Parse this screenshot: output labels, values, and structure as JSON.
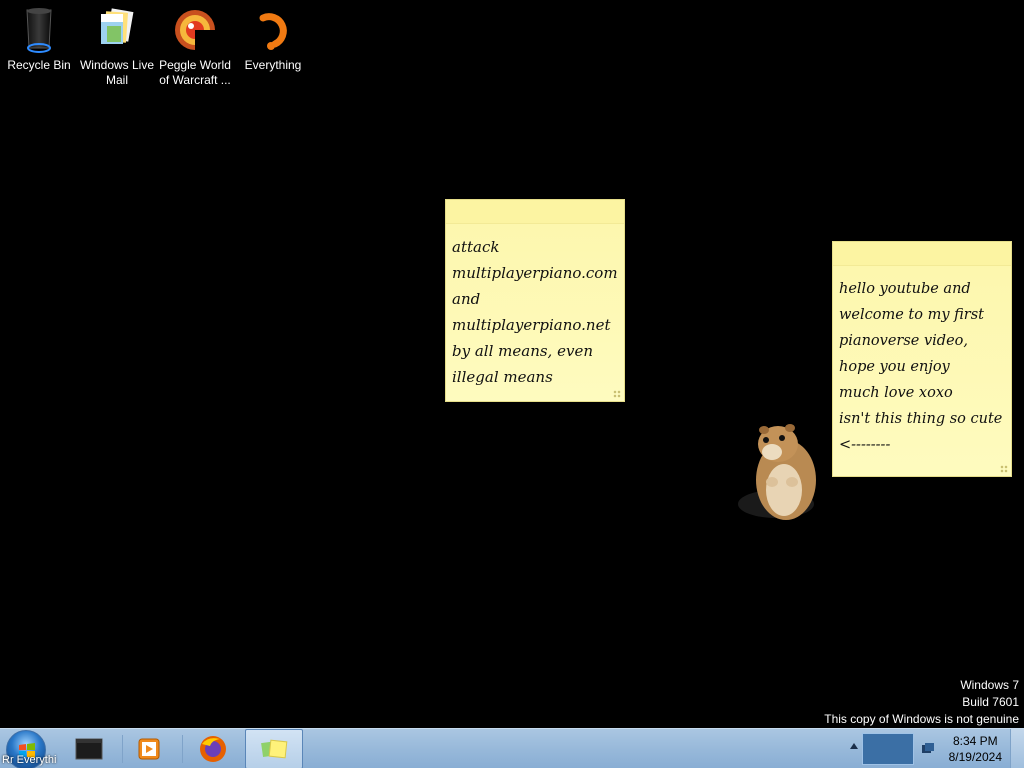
{
  "desktop_icons": [
    {
      "label": "Recycle Bin",
      "icon": "recycle-bin-icon"
    },
    {
      "label": "Windows Live Mail",
      "icon": "windows-live-mail-icon"
    },
    {
      "label": "Peggle World of Warcraft ...",
      "icon": "peggle-icon"
    },
    {
      "label": "Everything",
      "icon": "everything-search-icon"
    }
  ],
  "sticky_notes": [
    {
      "lines": [
        "attack",
        "multiplayerpiano.com",
        "and",
        "multiplayerpiano.net",
        "by all means, even",
        "illegal means"
      ]
    },
    {
      "lines": [
        "hello youtube and",
        "welcome to my first",
        "pianoverse video,",
        "hope you enjoy",
        "much love xoxo",
        "isn't this thing so cute",
        "<--------"
      ]
    }
  ],
  "watermark": {
    "line1": "Windows 7",
    "line2": "Build 7601",
    "line3": "This copy of Windows is not genuine"
  },
  "taskbar": {
    "start_overlay_text": "Rr Everythi",
    "pinned": [
      {
        "icon": "terminal-icon"
      },
      {
        "icon": "media-player-icon"
      },
      {
        "icon": "firefox-icon"
      },
      {
        "icon": "sticky-notes-icon",
        "active": true
      }
    ],
    "clock": {
      "time": "8:34 PM",
      "date": "8/19/2024"
    }
  },
  "colors": {
    "desktop": "#000000",
    "note": "#fefbbf",
    "taskbar": "#98b9da"
  }
}
